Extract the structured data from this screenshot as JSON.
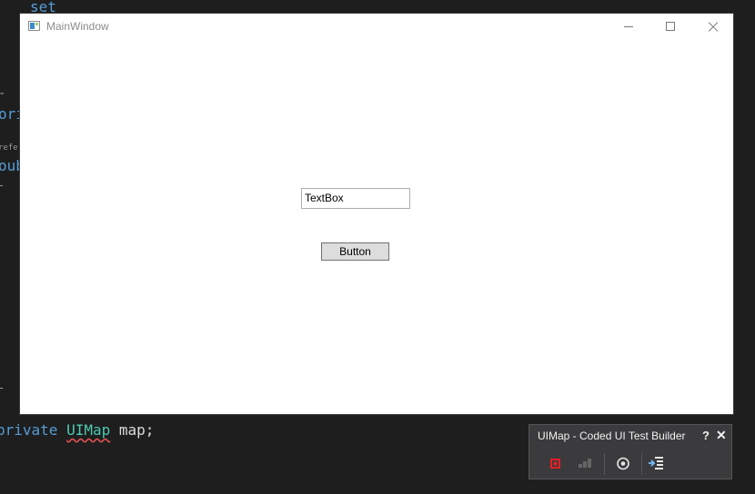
{
  "editor": {
    "line_top": "set",
    "line_private": "ori",
    "line_reference": "refere",
    "line_public": "oub",
    "line_bottom": {
      "keyword": "private",
      "type": "UIMap",
      "rest": "map;"
    }
  },
  "window": {
    "title": "MainWindow",
    "textbox_value": "TextBox",
    "button_label": "Button"
  },
  "builder": {
    "title": "UIMap - Coded UI Test Builder",
    "help": "?",
    "close": "✕"
  },
  "colors": {
    "record_red": "#e51e25",
    "accent_blue": "#75beff",
    "keyword": "#569cd6",
    "type": "#4ec9b0"
  }
}
